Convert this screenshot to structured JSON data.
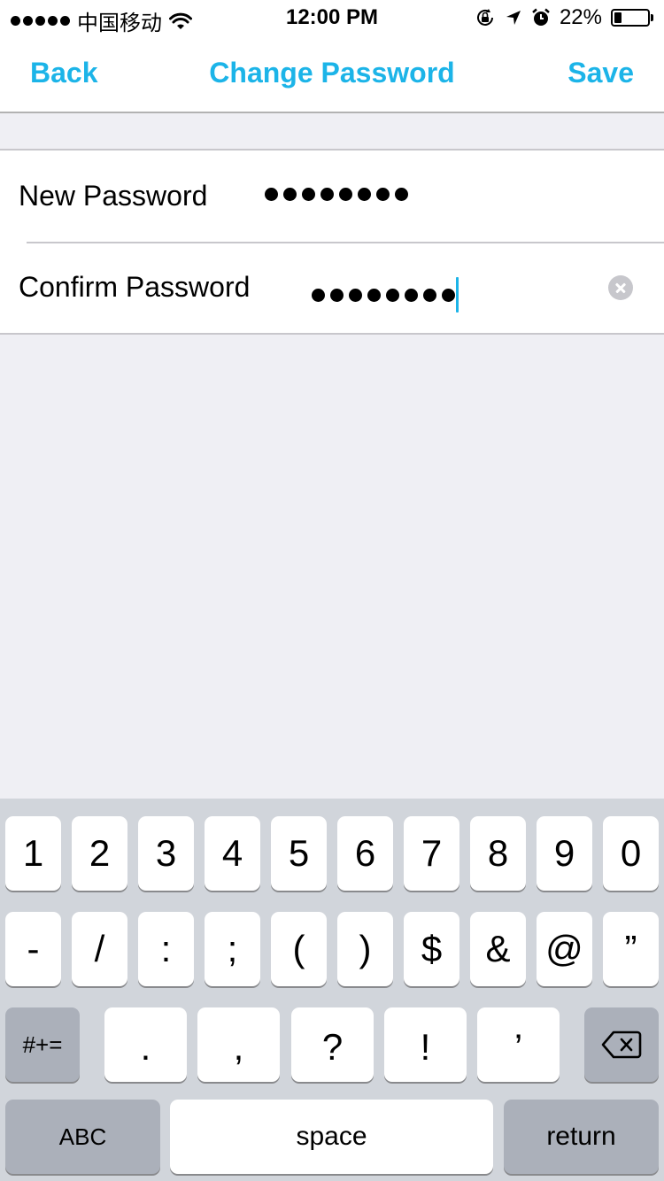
{
  "status_bar": {
    "signal_dots": 5,
    "carrier": "中国移动",
    "time": "12:00 PM",
    "battery_percent_label": "22%",
    "battery_level": 0.22,
    "icons": [
      "signal-icon",
      "wifi-icon",
      "orientation-lock-icon",
      "location-arrow-icon",
      "alarm-icon",
      "battery-icon"
    ]
  },
  "nav": {
    "back_label": "Back",
    "title": "Change Password",
    "save_label": "Save",
    "accent_color": "#1cb4e8"
  },
  "form": {
    "new_password": {
      "label": "New Password",
      "masked_length": 8
    },
    "confirm_password": {
      "label": "Confirm Password",
      "masked_length": 8,
      "focused": true,
      "clear_icon": "clear-circle-icon"
    }
  },
  "keyboard": {
    "row1": [
      "1",
      "2",
      "3",
      "4",
      "5",
      "6",
      "7",
      "8",
      "9",
      "0"
    ],
    "row2": [
      "-",
      "/",
      ":",
      ";",
      "(",
      ")",
      "$",
      "&",
      "@",
      "”"
    ],
    "row3": {
      "shift_label": "#+=",
      "keys": [
        ".",
        ",",
        "?",
        "!",
        "’"
      ],
      "delete_icon": "backspace-icon"
    },
    "row4": {
      "abc_label": "ABC",
      "space_label": "space",
      "return_label": "return"
    }
  }
}
